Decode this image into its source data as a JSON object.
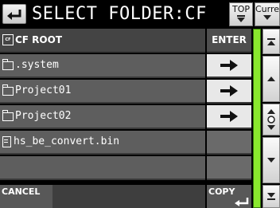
{
  "header": {
    "title": "SELECT FOLDER:CF",
    "top_button": "TOP",
    "current_button": "Current"
  },
  "root_row": {
    "label": "CF ROOT",
    "action": "ENTER"
  },
  "items": [
    {
      "name": ".system",
      "type": "folder"
    },
    {
      "name": "Project01",
      "type": "folder"
    },
    {
      "name": "Project02",
      "type": "folder"
    },
    {
      "name": "hs_be_convert.bin",
      "type": "file"
    }
  ],
  "footer": {
    "cancel": "CANCEL",
    "copy": "COPY"
  },
  "colors": {
    "background": "#000000",
    "row": "#5e5e5e",
    "scrollbar": "#6cd417"
  },
  "icons": [
    "back-arrow-icon",
    "folder-icon",
    "file-icon",
    "cf-card-icon",
    "right-arrow-icon",
    "scroll-top-icon",
    "scroll-up-icon",
    "scroll-down-icon",
    "scroll-bottom-icon"
  ]
}
